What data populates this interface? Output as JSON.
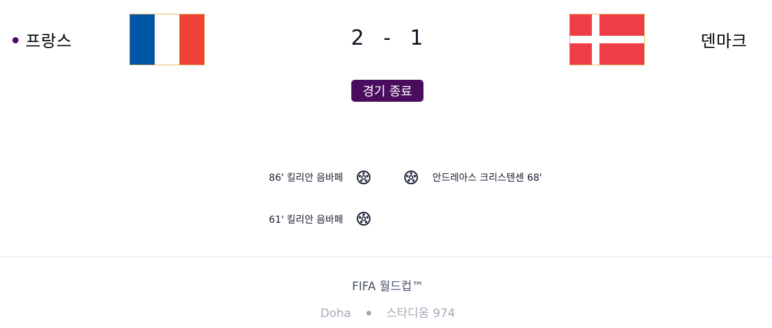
{
  "match": {
    "home_team": "프랑스",
    "away_team": "덴마크",
    "home_score": "2",
    "score_separator": "-",
    "away_score": "1",
    "status": "경기 종료"
  },
  "flags": {
    "home": {
      "name": "france-flag-icon",
      "colors": [
        "#0055a4",
        "#ffffff",
        "#ef4135"
      ]
    },
    "away": {
      "name": "denmark-flag-icon",
      "colors": [
        "#ef3d46",
        "#ffffff"
      ]
    }
  },
  "goals": {
    "home": [
      {
        "text": "86' 킬리안 음바페",
        "icon": "soccer-ball-icon"
      },
      {
        "text": "61' 킬리안 음바페",
        "icon": "soccer-ball-icon"
      }
    ],
    "away": [
      {
        "text": "안드레아스 크리스텐센 68'",
        "icon": "soccer-ball-icon"
      }
    ]
  },
  "footer": {
    "competition": "FIFA 월드컵™",
    "city": "Doha",
    "stadium": "스타디움 974"
  },
  "colors": {
    "accent": "#4a0d5e",
    "muted": "#a4aab8",
    "competition_text": "#4a5068"
  }
}
